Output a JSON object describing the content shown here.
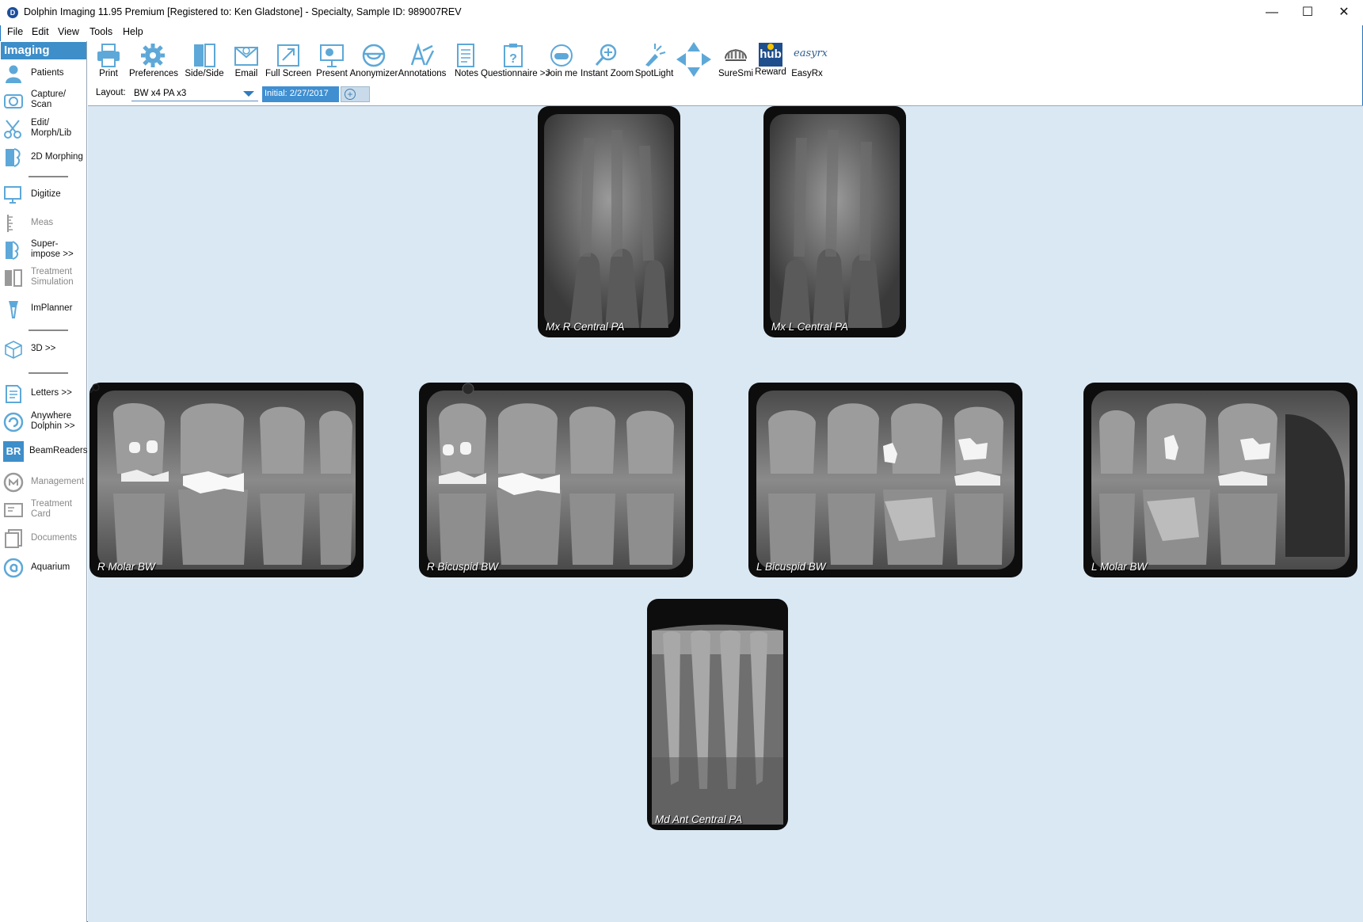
{
  "window": {
    "title": "Dolphin Imaging 11.95 Premium [Registered to: Ken Gladstone] - Specialty, Sample  ID: 989007REV",
    "minimize": "—",
    "maximize": "☐",
    "close": "✕"
  },
  "menu": [
    "File",
    "Edit",
    "View",
    "Tools",
    "Help"
  ],
  "sidebar": {
    "header": "Imaging",
    "items": [
      {
        "label": "Patients",
        "icon": "person-icon",
        "enabled": true
      },
      {
        "label": "Capture/\nScan",
        "icon": "camera-icon",
        "enabled": true
      },
      {
        "label": "Edit/\nMorph/Lib",
        "icon": "scissors-icon",
        "enabled": true
      },
      {
        "label": "2D Morphing",
        "icon": "profile-morph-icon",
        "enabled": true
      },
      {
        "label": "Digitize",
        "icon": "digitize-icon",
        "enabled": true
      },
      {
        "label": "Meas",
        "icon": "ruler-icon",
        "enabled": false
      },
      {
        "label": "Super-\nimpose >>",
        "icon": "superimpose-icon",
        "enabled": true
      },
      {
        "label": "Treatment\nSimulation",
        "icon": "treatment-sim-icon",
        "enabled": false
      },
      {
        "label": "ImPlanner",
        "icon": "implant-icon",
        "enabled": true
      },
      {
        "label": "3D >>",
        "icon": "cube-icon",
        "enabled": true
      },
      {
        "label": "Letters >>",
        "icon": "letters-icon",
        "enabled": true
      },
      {
        "label": "Anywhere\nDolphin >>",
        "icon": "anywhere-icon",
        "enabled": true
      },
      {
        "label": "BeamReaders",
        "icon": "br-icon",
        "enabled": true
      },
      {
        "label": "Management",
        "icon": "management-icon",
        "enabled": false
      },
      {
        "label": "Treatment\nCard",
        "icon": "card-icon",
        "enabled": false
      },
      {
        "label": "Documents",
        "icon": "documents-icon",
        "enabled": false
      },
      {
        "label": "Aquarium",
        "icon": "aquarium-icon",
        "enabled": true
      }
    ],
    "br_badge": "BR"
  },
  "toolbar": [
    {
      "label": "Print",
      "icon": "printer-icon"
    },
    {
      "label": "Preferences",
      "icon": "gear-icon"
    },
    {
      "label": "Side/Side",
      "icon": "side-by-side-icon"
    },
    {
      "label": "Email",
      "icon": "email-icon"
    },
    {
      "label": "Full Screen",
      "icon": "fullscreen-icon"
    },
    {
      "label": "Present",
      "icon": "present-icon"
    },
    {
      "label": "Anonymizer",
      "icon": "anonymizer-icon"
    },
    {
      "label": "Annotations",
      "icon": "annotations-icon"
    },
    {
      "label": "Notes",
      "icon": "notes-icon"
    },
    {
      "label": "Questionnaire >>",
      "icon": "questionnaire-icon"
    },
    {
      "label": "Join me",
      "icon": "joinme-icon"
    },
    {
      "label": "Instant Zoom",
      "icon": "zoom-icon"
    },
    {
      "label": "SpotLight",
      "icon": "spotlight-icon"
    },
    {
      "label": "",
      "icon": "move-arrows-icon"
    },
    {
      "label": "SureSmi",
      "icon": "suresmile-icon"
    },
    {
      "label": "Reward",
      "icon": "hub-icon"
    },
    {
      "label": "EasyRx",
      "icon": "easyrx-icon"
    }
  ],
  "toolbar_badges": {
    "hub": "hub",
    "easyrx": "easyrx"
  },
  "layout": {
    "label": "Layout:",
    "value": "BW x4 PA x3",
    "date_tab": "Initial: 2/27/2017"
  },
  "xrays": [
    {
      "label": "Mx R Central PA",
      "kind": "pa-upper"
    },
    {
      "label": "Mx L Central PA",
      "kind": "pa-upper"
    },
    {
      "label": "R Molar BW",
      "kind": "bw"
    },
    {
      "label": "R Bicuspid BW",
      "kind": "bw"
    },
    {
      "label": "L Bicuspid BW",
      "kind": "bw"
    },
    {
      "label": "L Molar BW",
      "kind": "bw"
    },
    {
      "label": "Md Ant Central PA",
      "kind": "pa-lower"
    }
  ]
}
